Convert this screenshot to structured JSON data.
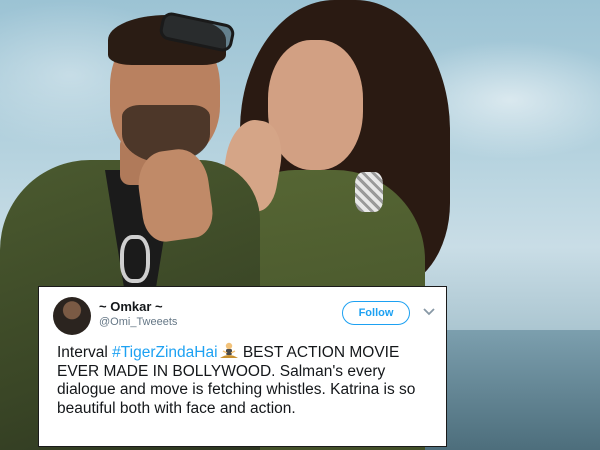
{
  "tweet": {
    "display_name": "~ Omkar ~",
    "handle": "@Omi_Tweeets",
    "follow_label": "Follow",
    "text_before_hashtag": "Interval ",
    "hashtag": "#TigerZindaHai",
    "text_after_hashtag": " BEST ACTION MOVIE EVER MADE IN BOLLYWOOD. Salman's every dialogue and move is fetching whistles. Katrina is so beautiful both with face and action.",
    "emoji": "person-in-lotus-position-emoji"
  },
  "colors": {
    "link": "#1da1f2",
    "text": "#14171a",
    "muted": "#657786"
  }
}
